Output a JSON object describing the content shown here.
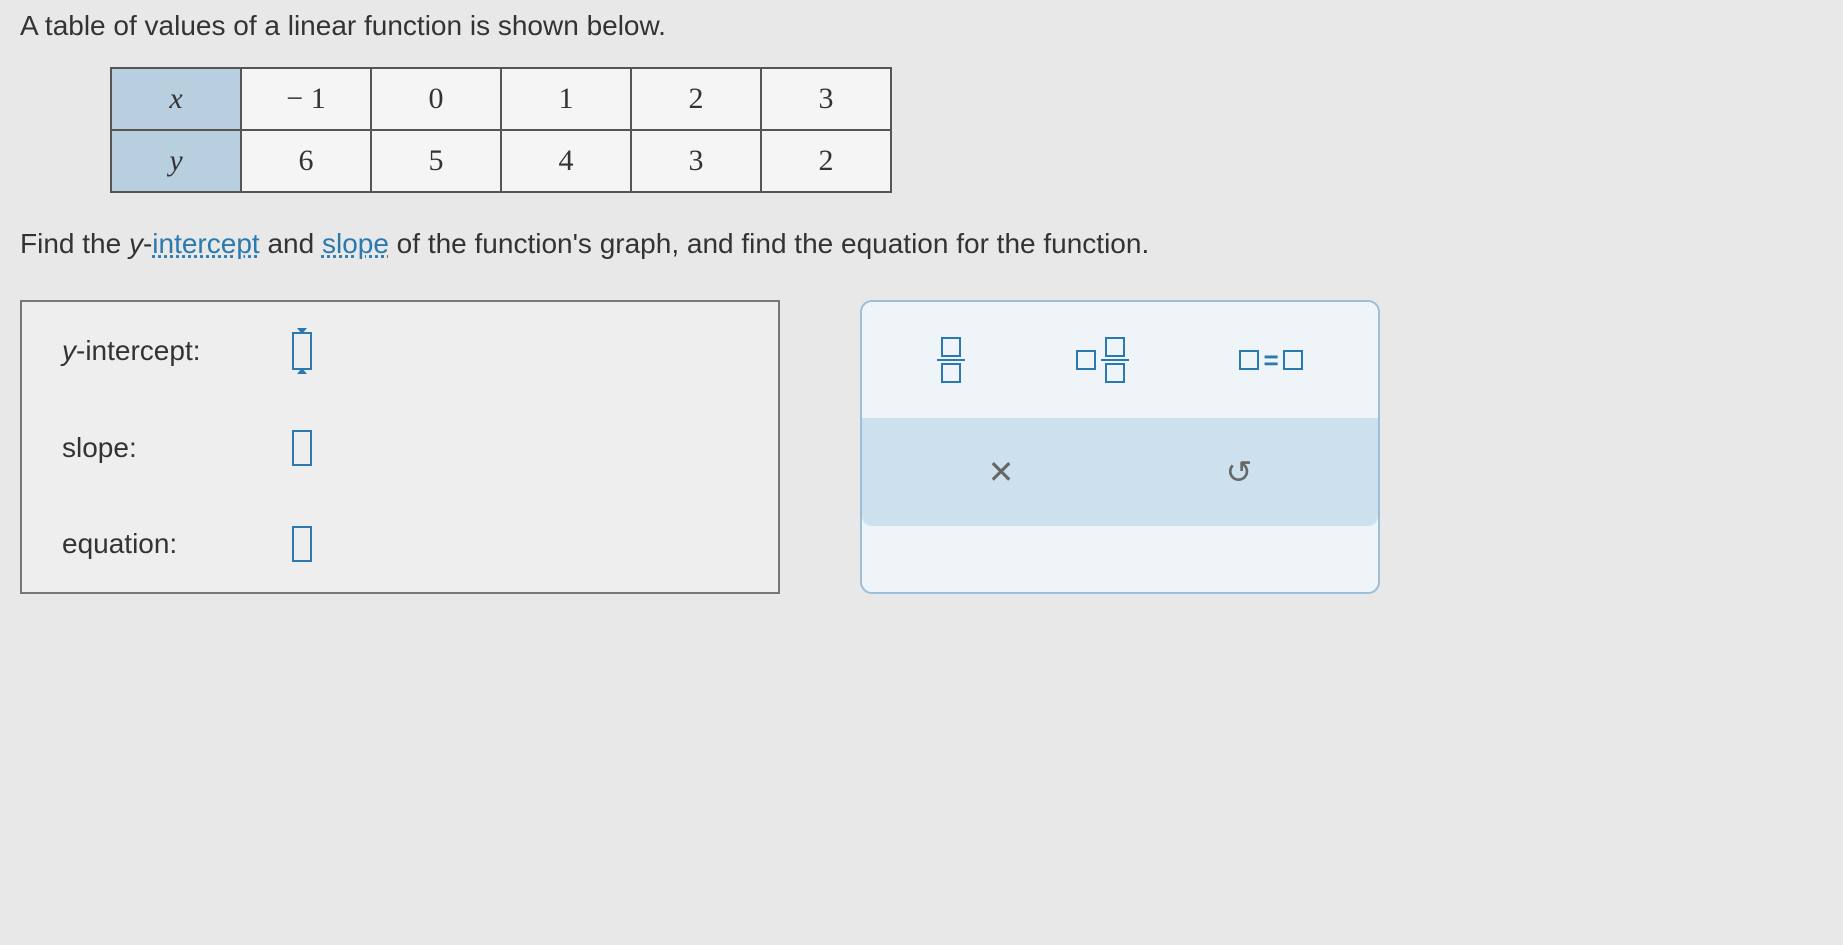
{
  "intro": "A table of values of a linear function is shown below.",
  "table": {
    "row1": {
      "header": "x",
      "values": [
        "− 1",
        "0",
        "1",
        "2",
        "3"
      ]
    },
    "row2": {
      "header": "y",
      "values": [
        "6",
        "5",
        "4",
        "3",
        "2"
      ]
    }
  },
  "question": {
    "part1": "Find the ",
    "ylabel": "y",
    "dash": "-",
    "link1": "intercept",
    "part2": " and ",
    "link2": "slope",
    "part3": " of the function's graph, and find the equation for the function."
  },
  "answers": {
    "yintercept_label": "y-intercept:",
    "slope_label": "slope:",
    "equation_label": "equation:"
  },
  "tools": {
    "clear": "✕",
    "undo": "↺"
  }
}
